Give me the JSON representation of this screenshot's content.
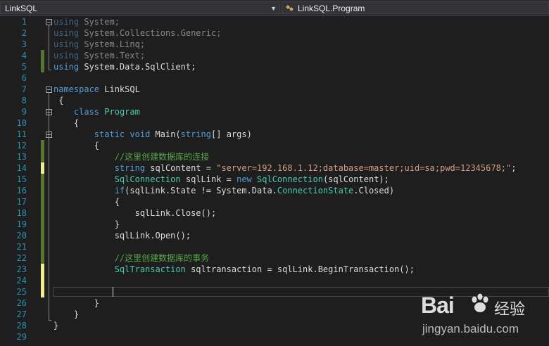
{
  "nav": {
    "project": "LinkSQL",
    "member": "LinkSQL.Program",
    "dropdown_icon": "chevron-down-icon",
    "member_icon": "class-icon"
  },
  "colors": {
    "background": "#1e1e1e",
    "keyword": "#569cd6",
    "type": "#4ec9b0",
    "string": "#d69d85",
    "comment": "#57a64a",
    "line_number": "#2b91af",
    "change_saved": "#577430",
    "change_unsaved": "#efef91"
  },
  "editor": {
    "line_numbers": [
      "1",
      "2",
      "3",
      "4",
      "5",
      "6",
      "7",
      "8",
      "9",
      "10",
      "11",
      "12",
      "13",
      "14",
      "15",
      "16",
      "17",
      "18",
      "19",
      "20",
      "21",
      "22",
      "23",
      "24",
      "25",
      "26",
      "27",
      "28",
      "29"
    ],
    "lines": {
      "l1": {
        "a": "using",
        "b": " System;"
      },
      "l2": {
        "a": "using",
        "b": " System.Collections.Generic;"
      },
      "l3": {
        "a": "using",
        "b": " System.Linq;"
      },
      "l4": {
        "a": "using",
        "b": " System.Text;"
      },
      "l5": {
        "a": "using",
        "b": " System.Data.SqlClient;"
      },
      "l7": {
        "a": "namespace",
        "b": " LinkSQL"
      },
      "l8": {
        "a": " {"
      },
      "l9": {
        "a": "    ",
        "b": "class",
        "c": " ",
        "d": "Program"
      },
      "l10": {
        "a": "    {"
      },
      "l11": {
        "a": "        ",
        "b": "static",
        "c": " ",
        "d": "void",
        "e": " Main(",
        "f": "string",
        "g": "[] args)"
      },
      "l12": {
        "a": "        {"
      },
      "l13": {
        "a": "            ",
        "b": "//这里创建数据库的连接"
      },
      "l14": {
        "a": "            ",
        "b": "string",
        "c": " sqlContent = ",
        "d": "\"server=192.168.1.12;database=master;uid=sa;pwd=12345678;\"",
        "e": ";"
      },
      "l15": {
        "a": "            ",
        "b": "SqlConnection",
        "c": " sqlLink = ",
        "d": "new",
        "e": " ",
        "f": "SqlConnection",
        "g": "(sqlContent);"
      },
      "l16": {
        "a": "            ",
        "b": "if",
        "c": "(sqlLink.State != System.Data.",
        "d": "ConnectionState",
        "e": ".Closed)"
      },
      "l17": {
        "a": "            {"
      },
      "l18": {
        "a": "                sqlLink.Close();"
      },
      "l19": {
        "a": "            }"
      },
      "l20": {
        "a": "            sqlLink.Open();"
      },
      "l22": {
        "a": "            ",
        "b": "//这里创建数据库的事务"
      },
      "l23": {
        "a": "            ",
        "b": "SqlTransaction",
        "c": " sqltransaction = sqlLink.BeginTransaction();"
      },
      "l26": {
        "a": "        }"
      },
      "l27": {
        "a": "    }"
      },
      "l28": {
        "a": "}"
      }
    }
  },
  "watermark": {
    "brand": "Bai",
    "brand_suffix": "经验",
    "url": "jingyan.baidu.com",
    "paw_icon": "baidu-paw-icon"
  }
}
